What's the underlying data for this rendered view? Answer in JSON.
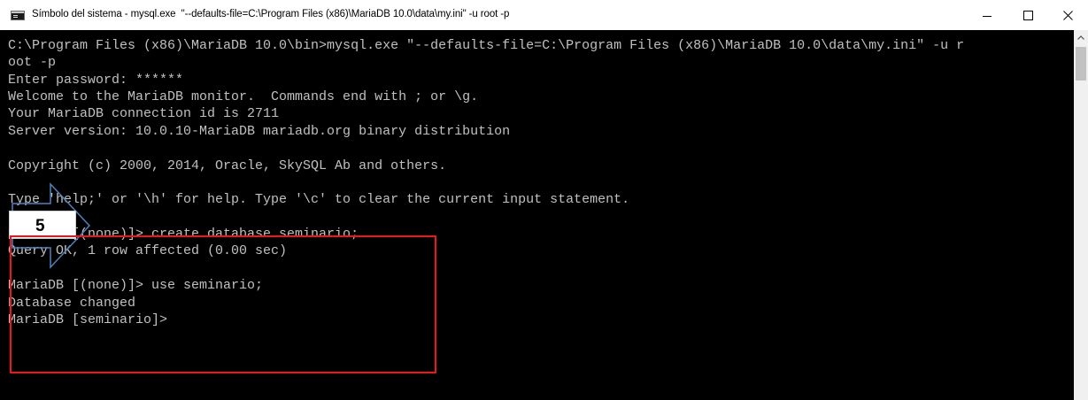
{
  "window": {
    "title": "Símbolo del sistema - mysql.exe  \"--defaults-file=C:\\Program Files (x86)\\MariaDB 10.0\\data\\my.ini\" -u root -p",
    "icon": "console-icon",
    "controls": [
      "minimize-icon",
      "maximize-icon",
      "close-icon"
    ]
  },
  "console": {
    "foreground": "#c0c0c0",
    "background": "#000000",
    "lines": [
      "C:\\Program Files (x86)\\MariaDB 10.0\\bin>mysql.exe \"--defaults-file=C:\\Program Files (x86)\\MariaDB 10.0\\data\\my.ini\" -u r",
      "oot -p",
      "Enter password: ******",
      "Welcome to the MariaDB monitor.  Commands end with ; or \\g.",
      "Your MariaDB connection id is 2711",
      "Server version: 10.0.10-MariaDB mariadb.org binary distribution",
      "",
      "Copyright (c) 2000, 2014, Oracle, SkySQL Ab and others.",
      "",
      "Type 'help;' or '\\h' for help. Type '\\c' to clear the current input statement.",
      "",
      "MariaDB [(none)]> create database seminario;",
      "Query OK, 1 row affected (0.00 sec)",
      "",
      "MariaDB [(none)]> use seminario;",
      "Database changed",
      "MariaDB [seminario]>"
    ]
  },
  "annotation": {
    "step_label": "5",
    "arrow_color": "#4f81bd",
    "box_color": "#e8181c"
  }
}
